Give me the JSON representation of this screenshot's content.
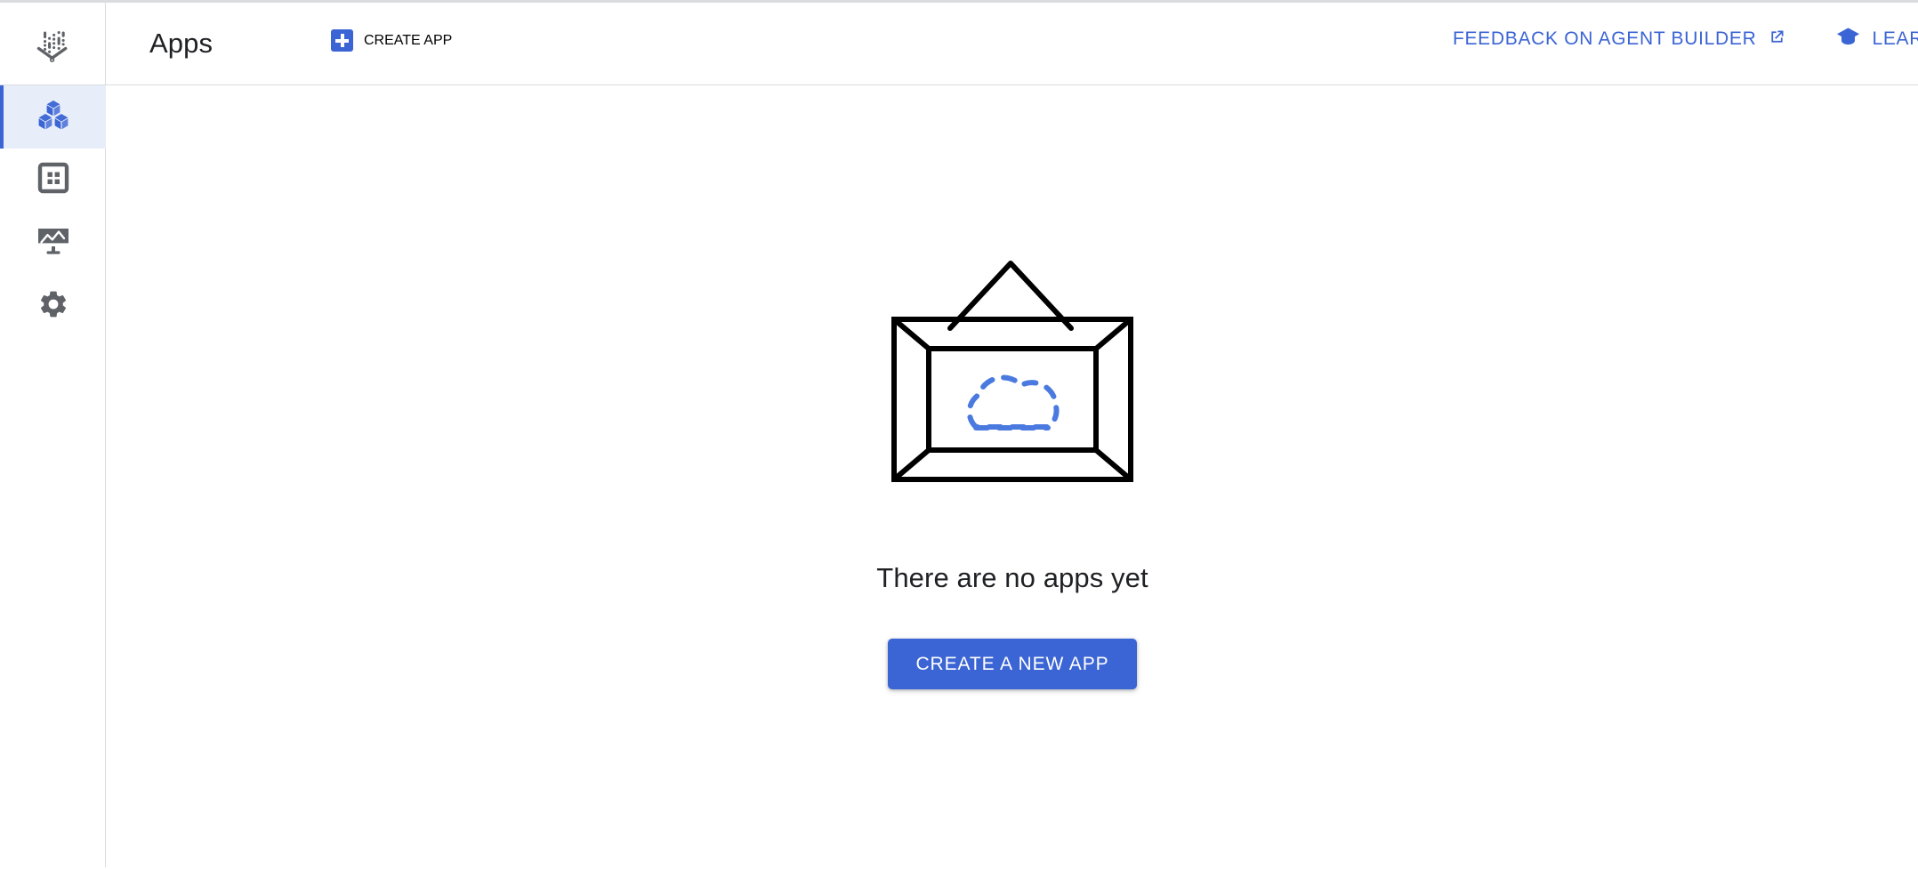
{
  "colors": {
    "accent_blue": "#3b64d4",
    "active_nav_bg": "#e8eef9",
    "icon_gray": "#5f6368",
    "border_gray": "#dadce0",
    "text_dark": "#202124",
    "illustration_outline": "#000000",
    "illustration_cloud": "#4a7ae0"
  },
  "header": {
    "logo_name": "vertex-ai-logo",
    "title": "Apps",
    "create_app": {
      "label": "CREATE APP",
      "icon": "plus-square-icon"
    },
    "actions": [
      {
        "label": "FEEDBACK ON AGENT BUILDER",
        "icon": "external-link-icon"
      },
      {
        "label": "LEARN",
        "icon": "graduation-cap-icon"
      }
    ]
  },
  "sidebar": {
    "items": [
      {
        "name": "apps",
        "icon": "cubes-icon",
        "active": true
      },
      {
        "name": "data-stores",
        "icon": "grid-squares-icon",
        "active": false
      },
      {
        "name": "monitoring",
        "icon": "monitor-chart-icon",
        "active": false
      },
      {
        "name": "settings",
        "icon": "gear-icon",
        "active": false
      }
    ]
  },
  "main": {
    "empty_state": {
      "illustration": "empty-picture-frame-with-dashed-cloud",
      "title": "There are no apps yet",
      "cta_label": "CREATE A NEW APP"
    }
  }
}
